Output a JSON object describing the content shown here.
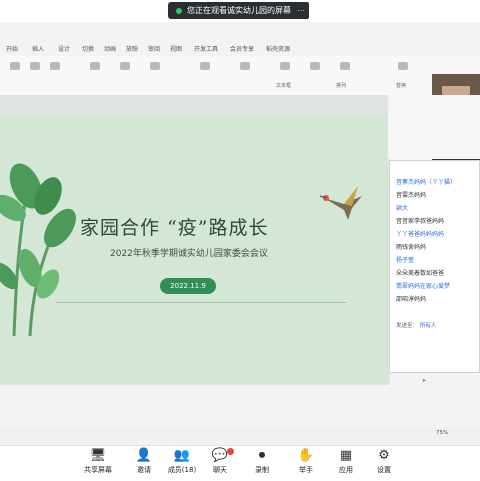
{
  "share_banner": {
    "text": "您正在观看诚实幼儿园的屏幕"
  },
  "ribbon": {
    "tabs": [
      "开始",
      "插入",
      "设计",
      "切换",
      "动画",
      "放映",
      "审阅",
      "视图",
      "开发工具",
      "会员专享",
      "稻壳资源"
    ],
    "labels": [
      "文本框",
      "排列",
      "替换"
    ]
  },
  "slide": {
    "title": "家园合作 “疫”路成长",
    "subtitle": "2022年秋季学期诚实幼儿园家委会会议",
    "date": "2022.11.9"
  },
  "chat": {
    "messages": [
      {
        "text": "音寨杰妈妈（丫丫猫）",
        "color": "blue"
      },
      {
        "text": "音雲杰妈妈",
        "color": "dark"
      },
      {
        "text": "颖大",
        "color": "blue"
      },
      {
        "text": "音音家李叔爸妈妈",
        "color": "dark"
      },
      {
        "text": "丫丫爸爸妈妈妈妈",
        "color": "blue"
      },
      {
        "text": "雨钱舍妈妈",
        "color": "dark"
      },
      {
        "text": "杨子萱",
        "color": "blue"
      },
      {
        "text": "朵朵美着数如爸爸",
        "color": "dark"
      },
      {
        "text": "翡翠妈妈在家心爱梦",
        "color": "blue"
      },
      {
        "text": "邵昭淳妈妈",
        "color": "dark"
      }
    ],
    "send_to_label": "发送至：",
    "send_to_value": "所有人"
  },
  "bottom_bar": {
    "buttons": [
      {
        "label": "共享屏幕",
        "icon": "screen-share-icon"
      },
      {
        "label": "邀请",
        "icon": "invite-icon"
      },
      {
        "label": "成员(18)",
        "icon": "members-icon"
      },
      {
        "label": "聊天",
        "icon": "chat-icon"
      },
      {
        "label": "录制",
        "icon": "record-icon"
      },
      {
        "label": "举手",
        "icon": "raise-hand-icon"
      },
      {
        "label": "应用",
        "icon": "apps-icon"
      },
      {
        "label": "设置",
        "icon": "settings-icon"
      }
    ]
  },
  "status": {
    "zoom": "75%"
  },
  "colors": {
    "slide_bg": "#d4e7d6",
    "accent_green": "#2f8f55",
    "link_blue": "#2a6fd6"
  }
}
